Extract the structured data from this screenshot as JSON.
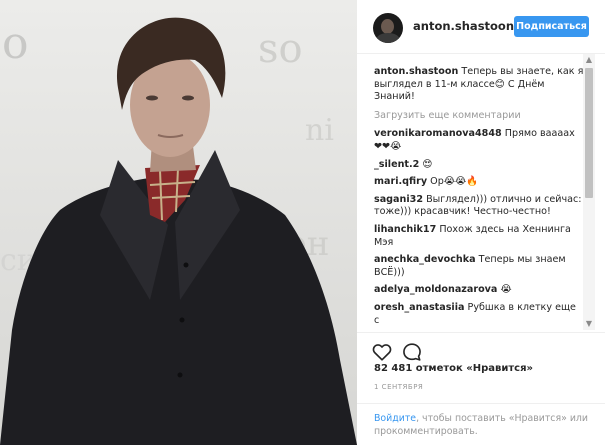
{
  "post": {
    "author": "anton.shastoon",
    "follow_label": "Подписаться",
    "caption": {
      "user": "anton.shastoon",
      "text": "Теперь вы знаете, как я выглядел в 11-м классе😊 С Днём Знаний!"
    },
    "load_more_label": "Загрузить еще комментарии",
    "comments": [
      {
        "user": "veronikaromanova4848",
        "text": "Прямо ваааах ❤❤😭"
      },
      {
        "user": "_silent.2",
        "text": "😍"
      },
      {
        "user": "mari.qfiry",
        "text": "Ор😭😭🔥"
      },
      {
        "user": "sagani32",
        "text": "Выглядел))) отлично и сейчас: тоже))) красавчик! Честно-честно!"
      },
      {
        "user": "lihanchik17",
        "text": "Похож здесь на Хеннинга Мэя"
      },
      {
        "user": "anechka_devochka",
        "text": "Теперь мы знаем ВСЁ)))"
      },
      {
        "user": "adelya_moldonazarova",
        "text": "😭"
      },
      {
        "user": "oresh_anastasiia",
        "text": "Рубшка в клетку еще с"
      }
    ],
    "likes_text": "82 481 отметок «Нравится»",
    "date": "1 сентября",
    "login_prompt": {
      "link": "Войдите",
      "rest": ", чтобы поставить «Нравится» или прокомментировать."
    },
    "icons": {
      "like": "heart-outline-icon",
      "comment": "comment-bubble-icon"
    },
    "colors": {
      "accent": "#3897f0",
      "text": "#262626",
      "muted": "#999999"
    }
  }
}
